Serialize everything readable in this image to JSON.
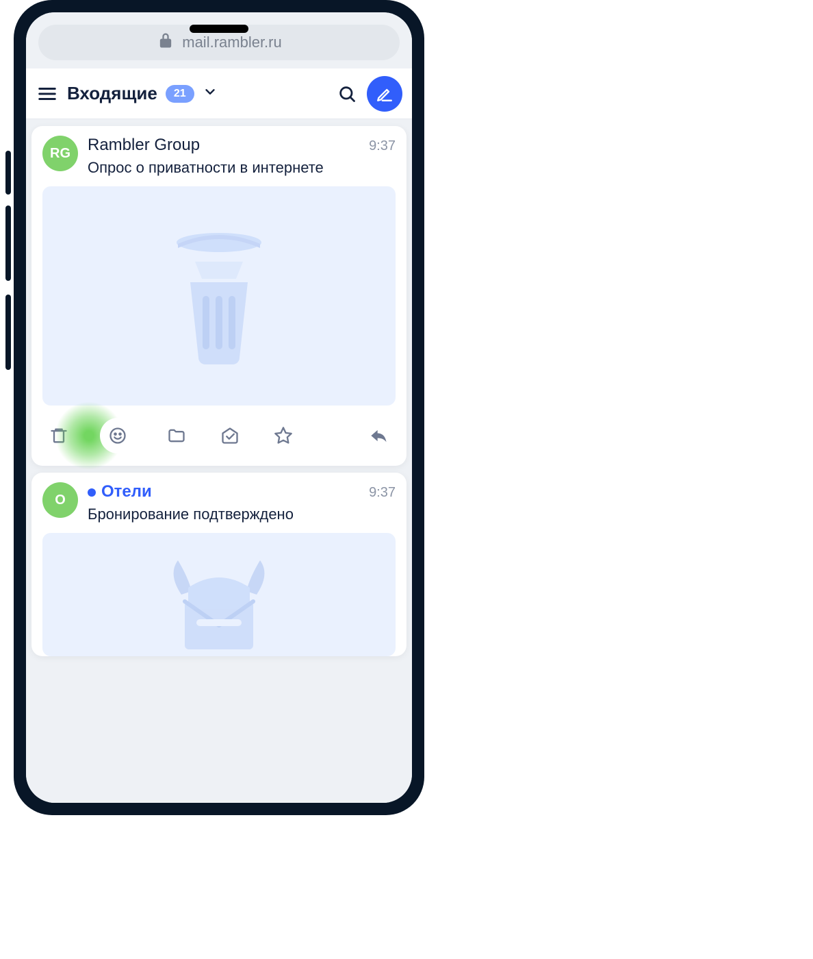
{
  "browser": {
    "url": "mail.rambler.ru"
  },
  "header": {
    "folder_title": "Входящие",
    "unread_count": "21"
  },
  "messages": [
    {
      "avatar_label": "RG",
      "sender": "Rambler Group",
      "time": "9:37",
      "subject": "Опрос о приватности в интернете",
      "unread": false,
      "preview_art": "trash"
    },
    {
      "avatar_label": "O",
      "sender": "Отели",
      "time": "9:37",
      "subject": "Бронирование подтверждено",
      "unread": true,
      "preview_art": "viking-envelope"
    }
  ],
  "icons": {
    "menu": "menu",
    "search": "search",
    "compose": "compose",
    "lock": "lock",
    "chevron": "chevron-down",
    "actions": [
      "trash",
      "smile",
      "folder",
      "mark-read",
      "star",
      "reply"
    ]
  },
  "colors": {
    "accent": "#315efb",
    "avatar_green": "#80d26b",
    "highlight": "#64d250"
  }
}
